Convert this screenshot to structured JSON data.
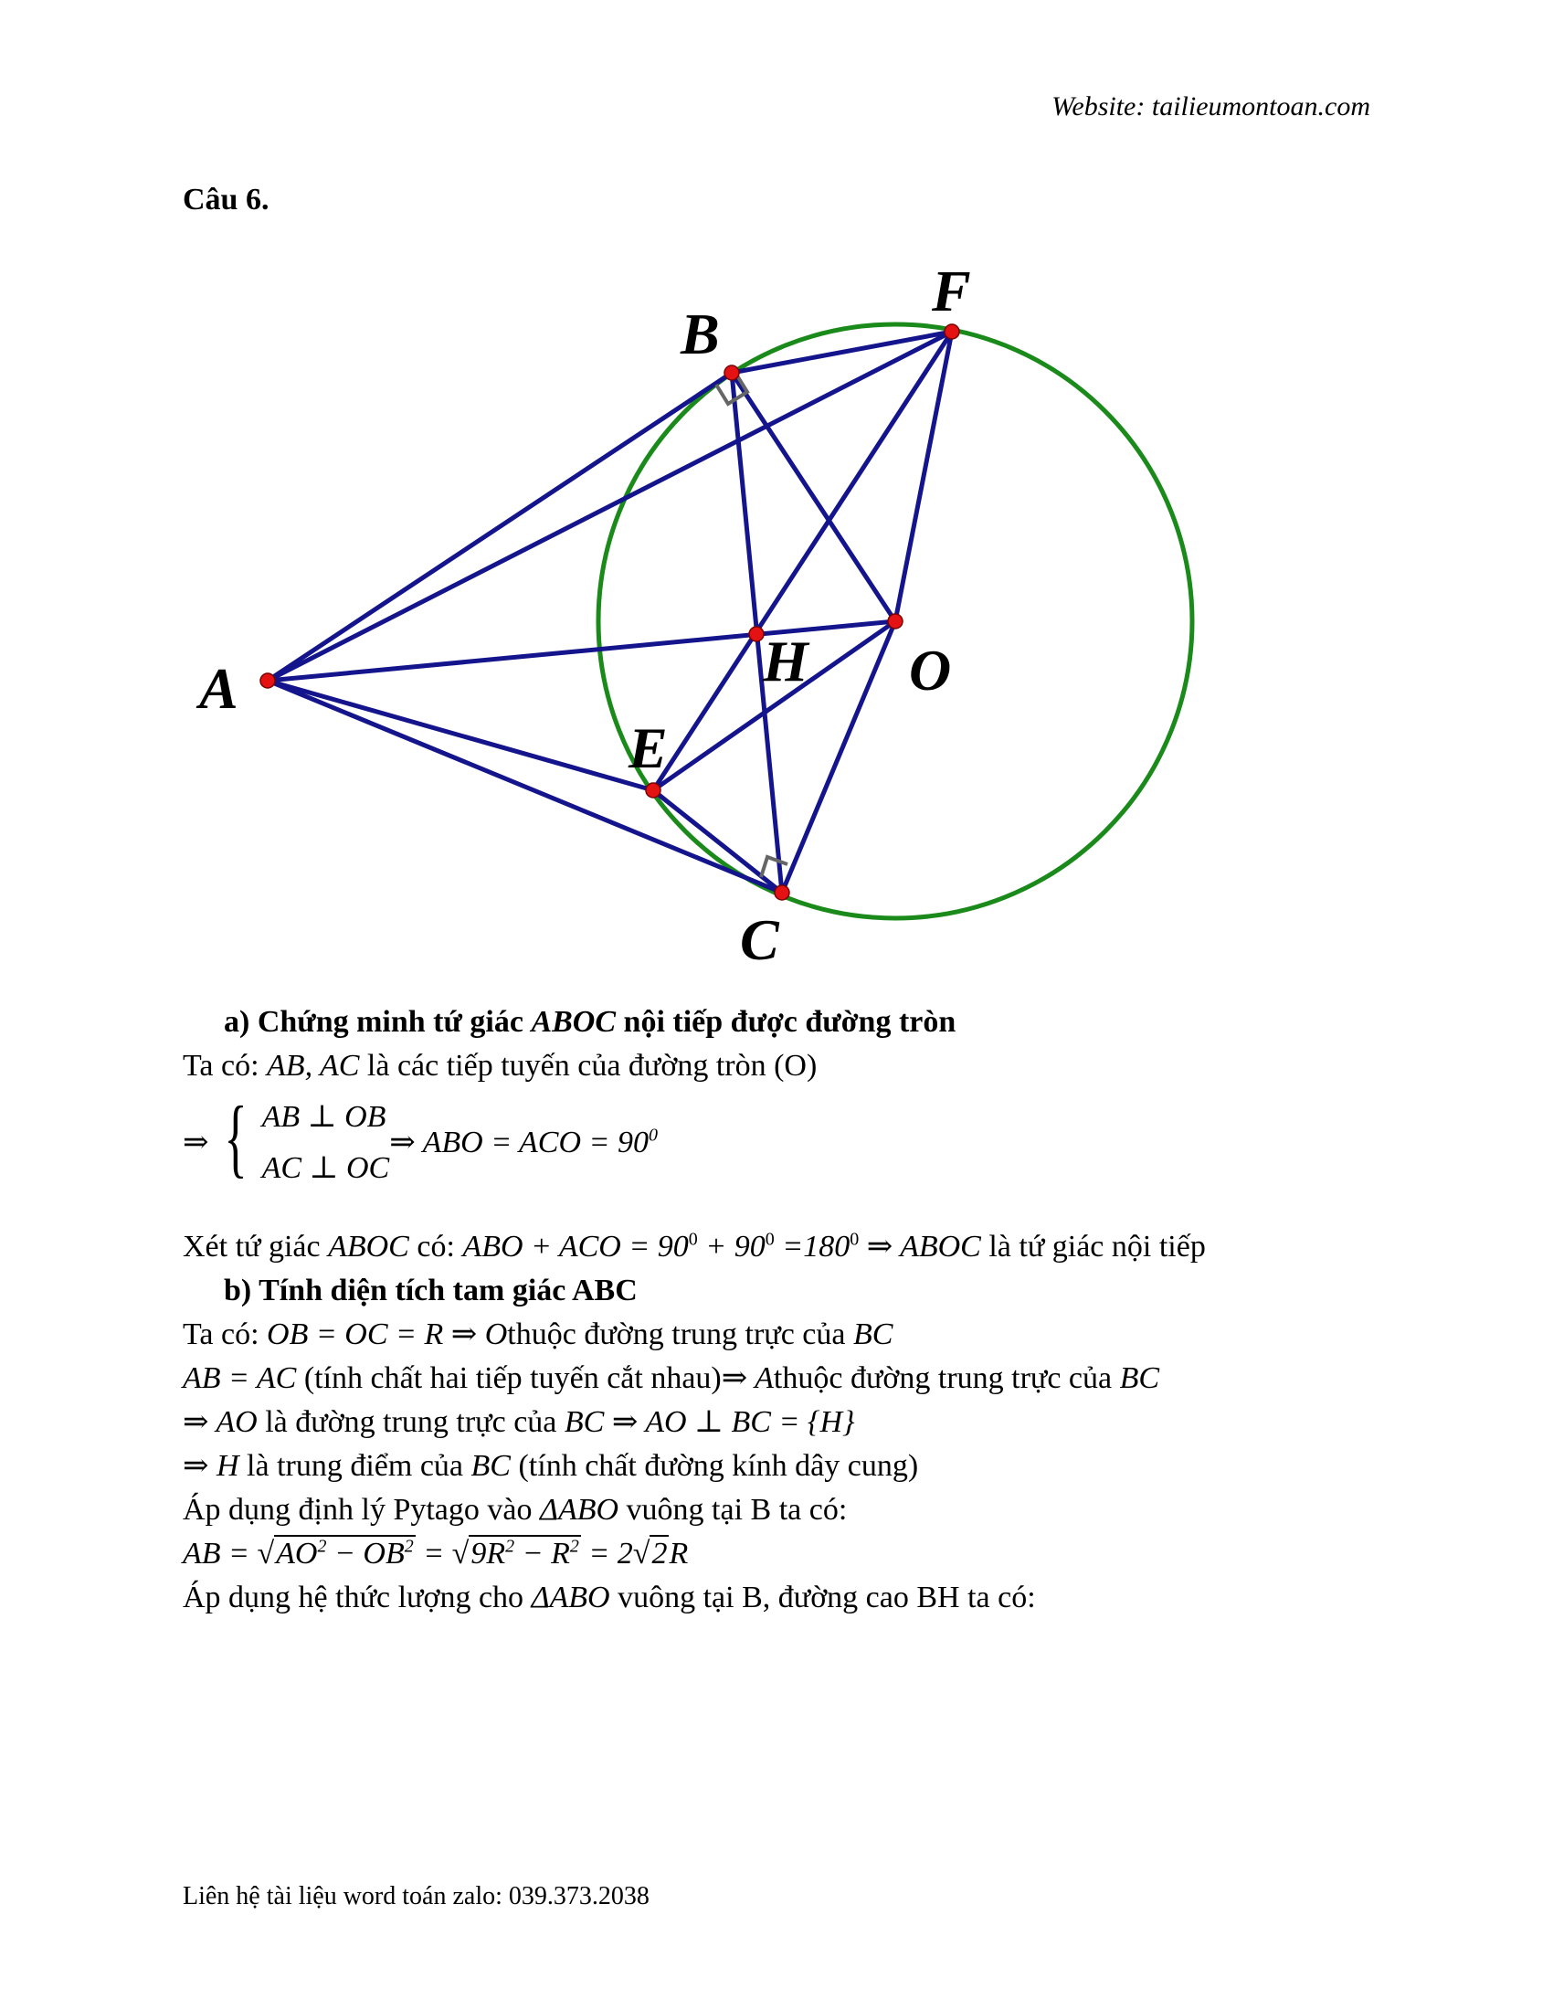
{
  "header": {
    "website": "Website: tailieumontoan.com"
  },
  "question_title": "Câu 6.",
  "figure": {
    "labels": {
      "A": "A",
      "B": "B",
      "C": "C",
      "E": "E",
      "F": "F",
      "H": "H",
      "O": "O"
    },
    "colors": {
      "circle": "#1a8a1a",
      "lines": "#14148c",
      "points": "#e41212",
      "right_angle": "#666666"
    }
  },
  "part_a": {
    "heading_prefix": "a)  Chứng minh tứ giác ",
    "heading_math": "ABOC",
    "heading_suffix": " nội tiếp được đường tròn",
    "line1_prefix": "Ta có: ",
    "line1_math": "AB, AC",
    "line1_suffix": " là các tiếp tuyến của đường tròn (O)",
    "implies": "⇒",
    "brace": "{",
    "sys_line1": "AB ⊥ OB",
    "sys_line2": "AC ⊥ OC",
    "sys_result": "⇒ ABO = ACO = 90",
    "sys_result_sup": "0",
    "xet_prefix": "Xét tứ giác ",
    "xet_math1": "ABOC",
    "xet_mid": " có: ",
    "xet_math2": "ABO + ACO = 90",
    "sup1": "0",
    "xet_math3": " + 90",
    "sup2": "0",
    "xet_math4": " =180",
    "sup3": "0",
    "xet_math5": " ⇒ ABOC",
    "xet_suffix": " là tứ giác nội tiếp"
  },
  "part_b": {
    "heading": "b)  Tính diện tích tam giác ABC",
    "l1_prefix": "Ta có: ",
    "l1_math": "OB = OC = R ⇒ O",
    "l1_mid": "thuộc đường trung trực của ",
    "l1_math2": "BC",
    "l2_math": "AB = AC",
    "l2_mid": " (tính chất hai tiếp tuyến cắt nhau)",
    "l2_math2": "⇒ A",
    "l2_mid2": "thuộc đường trung trực của ",
    "l2_math3": "BC",
    "l3_math": "⇒ AO",
    "l3_mid": " là đường trung trực của ",
    "l3_math2": "BC ⇒ AO ⊥ BC = {H}",
    "l4_math": "⇒ H",
    "l4_mid": " là trung điểm của ",
    "l4_math2": "BC",
    "l4_suffix": " (tính chất đường kính dây cung)",
    "l5_prefix": "Áp dụng định lý Pytago vào ",
    "l5_math": "ΔABO",
    "l5_suffix": " vuông tại B ta có:",
    "l6_a": "AB = √",
    "l6_b": "AO",
    "l6_sup1": "2",
    "l6_c": " − OB",
    "l6_sup2": "2",
    "l6_d": " = √",
    "l6_e": "9R",
    "l6_sup3": "2",
    "l6_f": " − R",
    "l6_sup4": "2",
    "l6_g": " = 2√",
    "l6_h": "2",
    "l6_i": "R",
    "l7_prefix": "Áp dụng hệ thức lượng cho ",
    "l7_math": "ΔABO",
    "l7_suffix": " vuông tại B, đường cao BH ta có:"
  },
  "footer": "Liên hệ tài liệu word toán zalo: 039.373.2038"
}
